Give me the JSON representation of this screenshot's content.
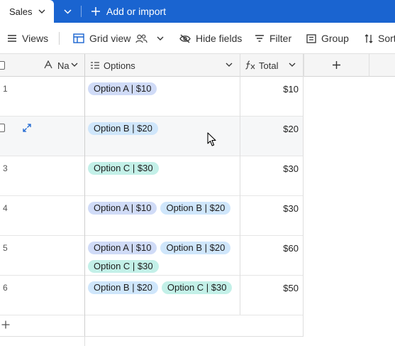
{
  "tabs": {
    "active_label": "Sales",
    "add_label": "Add or import"
  },
  "toolbar": {
    "views_label": "Views",
    "grid_view_label": "Grid view",
    "hide_fields_label": "Hide fields",
    "filter_label": "Filter",
    "group_label": "Group",
    "sort_label": "Sort"
  },
  "columns": {
    "name_label": "Na",
    "options_label": "Options",
    "total_label": "Total"
  },
  "colors": {
    "accent": "#1a64d0",
    "option_a": "#d0dbf7",
    "option_b": "#cfe6fb",
    "option_c": "#c3f0e8"
  },
  "rows": [
    {
      "num": "1",
      "options": [
        {
          "label": "Option A | $10",
          "kind": "a"
        }
      ],
      "total": "$10"
    },
    {
      "num": "",
      "options": [
        {
          "label": "Option B | $20",
          "kind": "b"
        }
      ],
      "total": "$20"
    },
    {
      "num": "3",
      "options": [
        {
          "label": "Option C | $30",
          "kind": "c"
        }
      ],
      "total": "$30"
    },
    {
      "num": "4",
      "options": [
        {
          "label": "Option A | $10",
          "kind": "a"
        },
        {
          "label": "Option B | $20",
          "kind": "b"
        }
      ],
      "total": "$30"
    },
    {
      "num": "5",
      "options": [
        {
          "label": "Option A | $10",
          "kind": "a"
        },
        {
          "label": "Option B | $20",
          "kind": "b"
        },
        {
          "label": "Option C | $30",
          "kind": "c"
        }
      ],
      "total": "$60"
    },
    {
      "num": "6",
      "options": [
        {
          "label": "Option B | $20",
          "kind": "b"
        },
        {
          "label": "Option C | $30",
          "kind": "c"
        }
      ],
      "total": "$50"
    }
  ]
}
